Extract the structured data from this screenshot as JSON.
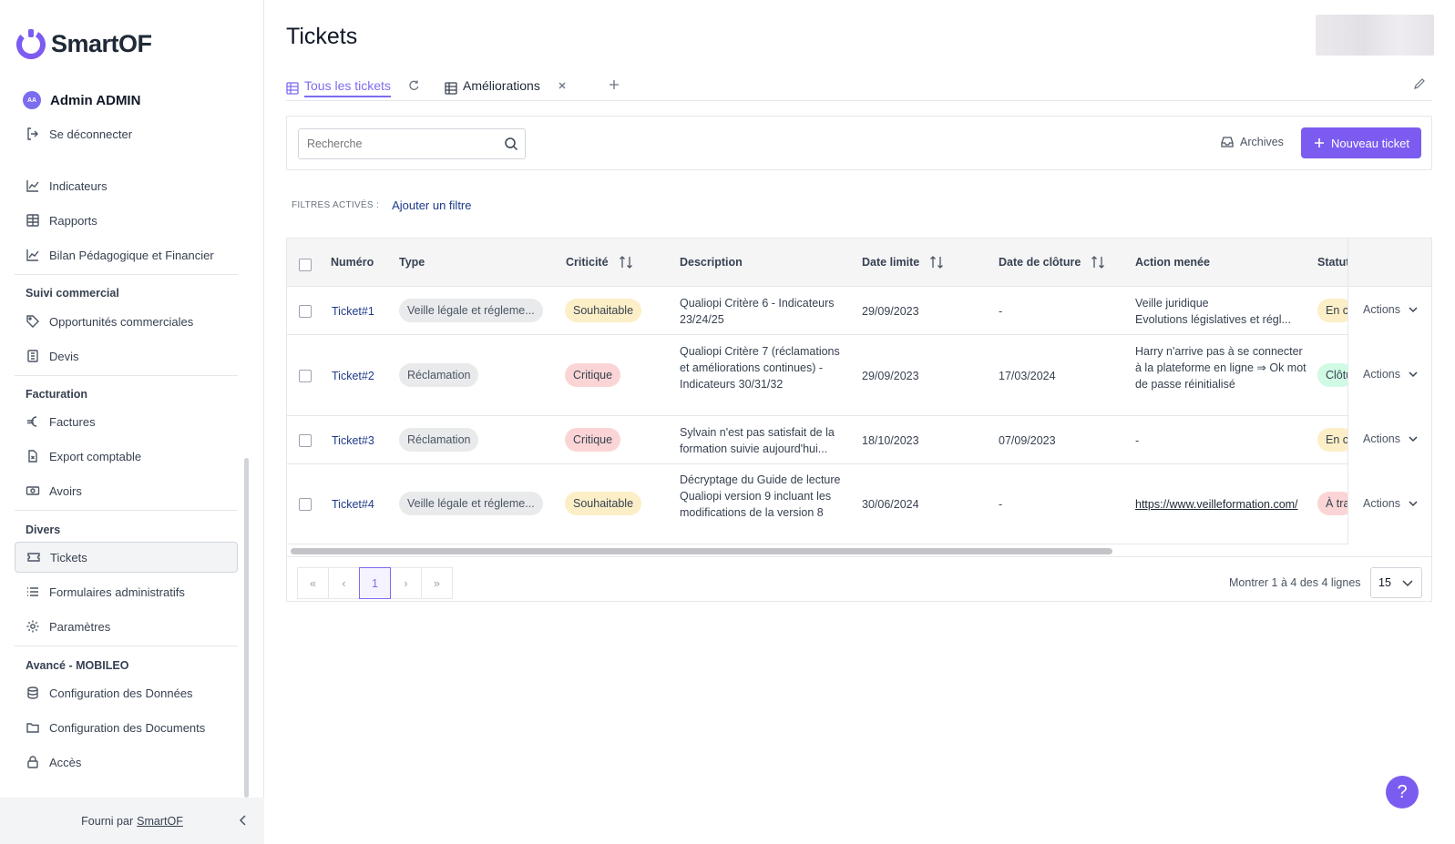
{
  "brand": {
    "name": "SmartOF",
    "accent": "#7c5cf0"
  },
  "user": {
    "initials": "AA",
    "name": "Admin ADMIN",
    "logout": "Se déconnecter"
  },
  "sidebar": {
    "items_top": [
      {
        "label": "Indicateurs",
        "icon": "line-chart-icon"
      },
      {
        "label": "Rapports",
        "icon": "table-icon"
      },
      {
        "label": "Bilan Pédagogique et Financier",
        "icon": "line-chart-icon"
      }
    ],
    "sections": [
      {
        "title": "Suivi commercial",
        "items": [
          {
            "label": "Opportunités commerciales",
            "icon": "tag-icon"
          },
          {
            "label": "Devis",
            "icon": "document-list-icon"
          }
        ]
      },
      {
        "title": "Facturation",
        "items": [
          {
            "label": "Factures",
            "icon": "euro-icon"
          },
          {
            "label": "Export comptable",
            "icon": "file-export-icon"
          },
          {
            "label": "Avoirs",
            "icon": "banknote-icon"
          }
        ]
      },
      {
        "title": "Divers",
        "items": [
          {
            "label": "Tickets",
            "icon": "ticket-icon"
          },
          {
            "label": "Formulaires administratifs",
            "icon": "list-icon"
          },
          {
            "label": "Paramètres",
            "icon": "gear-icon"
          }
        ]
      },
      {
        "title": "Avancé - MOBILEO",
        "items": [
          {
            "label": "Configuration des Données",
            "icon": "database-icon"
          },
          {
            "label": "Configuration des Documents",
            "icon": "folder-icon"
          },
          {
            "label": "Accès",
            "icon": "lock-icon"
          }
        ]
      }
    ],
    "footer_prefix": "Fourni par",
    "footer_link": "SmartOF"
  },
  "page": {
    "title": "Tickets"
  },
  "tabs": [
    {
      "label": "Tous les tickets",
      "active": true
    },
    {
      "label": "Améliorations",
      "active": false
    }
  ],
  "toolbar": {
    "search_placeholder": "Recherche",
    "archives": "Archives",
    "new_ticket": "Nouveau ticket"
  },
  "filters": {
    "label": "FILTRES ACTIVÉS :",
    "add": "Ajouter un filtre"
  },
  "table": {
    "columns": [
      "Numéro",
      "Type",
      "Criticité",
      "Description",
      "Date limite",
      "Date de clôture",
      "Action menée",
      "Statut"
    ],
    "rows": [
      {
        "num": "Ticket#1",
        "type": "Veille légale et régleme...",
        "criticity": "Souhaitable",
        "desc": "Qualiopi Critère 6 - Indicateurs 23/24/25",
        "deadline": "29/09/2023",
        "closed": "-",
        "action": "Veille juridique\nEvolutions législatives et régl...",
        "status": "En co"
      },
      {
        "num": "Ticket#2",
        "type": "Réclamation",
        "criticity": "Critique",
        "desc": "Qualiopi Critère 7 (réclamations et améliorations continues) - Indicateurs 30/31/32",
        "deadline": "29/09/2023",
        "closed": "17/03/2024",
        "action": "Harry n'arrive pas à se connecter à la plateforme en ligne ⇒ Ok mot de passe réinitialisé",
        "status": "Clôtu"
      },
      {
        "num": "Ticket#3",
        "type": "Réclamation",
        "criticity": "Critique",
        "desc": "Sylvain n'est pas satisfait de la formation suivie aujourd'hui...",
        "deadline": "18/10/2023",
        "closed": "07/09/2023",
        "action": "-",
        "status": "En co"
      },
      {
        "num": "Ticket#4",
        "type": "Veille légale et régleme...",
        "criticity": "Souhaitable",
        "desc": "Décryptage du Guide de lecture Qualiopi version 9 incluant les modifications de la version 8",
        "deadline": "30/06/2024",
        "closed": "-",
        "action": "https://www.veilleformation.com/",
        "status": "À tra"
      }
    ],
    "actions_label": "Actions"
  },
  "pagination": {
    "first": "«",
    "prev": "‹",
    "current": "1",
    "next": "›",
    "last": "»",
    "info": "Montrer 1 à 4 des 4 lignes",
    "page_size": "15"
  },
  "help": "?"
}
